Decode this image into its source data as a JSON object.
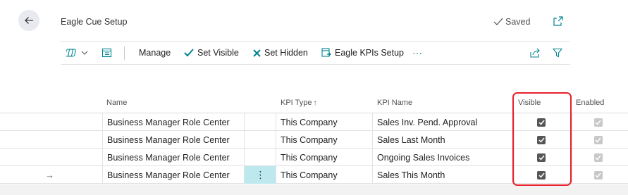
{
  "header": {
    "title": "Eagle Cue Setup",
    "saved_label": "Saved"
  },
  "actions": {
    "manage": "Manage",
    "set_visible": "Set Visible",
    "set_hidden": "Set Hidden",
    "kpis_setup": "Eagle KPIs Setup",
    "more": "···"
  },
  "columns": {
    "name": "Name",
    "kpi_type": "KPI Type",
    "kpi_type_sort": "↑",
    "kpi_name": "KPI Name",
    "visible": "Visible",
    "enabled": "Enabled"
  },
  "rows": [
    {
      "name": "Business Manager Role Center",
      "kpi_type": "This Company",
      "kpi_name": "Sales Inv. Pend. Approval",
      "visible": true,
      "enabled": true
    },
    {
      "name": "Business Manager Role Center",
      "kpi_type": "This Company",
      "kpi_name": "Sales Last Month",
      "visible": true,
      "enabled": true
    },
    {
      "name": "Business Manager Role Center",
      "kpi_type": "This Company",
      "kpi_name": "Ongoing Sales Invoices",
      "visible": true,
      "enabled": true
    },
    {
      "name": "Business Manager Role Center",
      "kpi_type": "This Company",
      "kpi_name": "Sales This Month",
      "visible": true,
      "enabled": true
    }
  ],
  "row_indicator": "→",
  "row_menu": "⋮",
  "colors": {
    "selected_cell": "#bde8ed",
    "highlight_box": "#e8202a",
    "accent": "#00838f"
  }
}
